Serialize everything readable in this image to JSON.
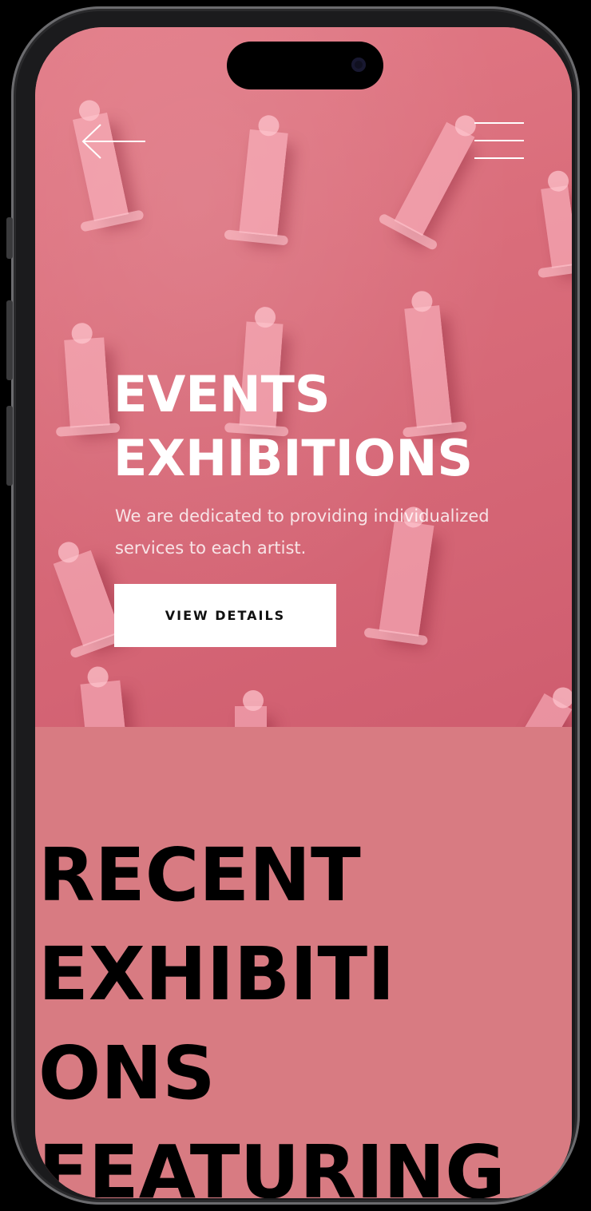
{
  "hero": {
    "title_line1": "EVENTS",
    "title_line2": "EXHIBITIONS",
    "subtitle": "We are dedicated to providing individualized services to each artist.",
    "cta_label": "VIEW DETAILS",
    "background_color": "#d96c7a"
  },
  "nav": {
    "back_icon": "arrow-left-icon",
    "menu_icon": "hamburger-menu-icon"
  },
  "section": {
    "title_line1": "RECENT",
    "title_line2": "EXHIBITI",
    "title_line3": "ONS",
    "title_line4": "FEATURING",
    "background_color": "#d87b82"
  },
  "colors": {
    "accent_pink": "#d87b82",
    "cta_background": "#ffffff",
    "cta_text": "#111111"
  }
}
